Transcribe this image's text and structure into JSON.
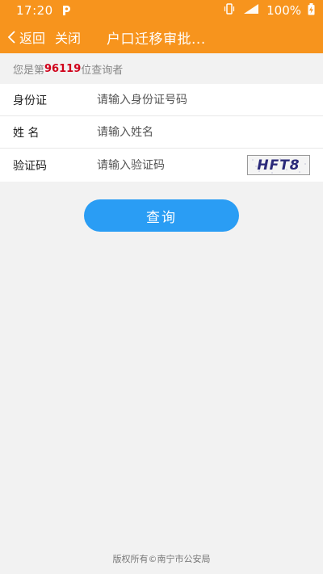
{
  "status_bar": {
    "time": "17:20",
    "battery": "100%",
    "icons": [
      "p-app-icon",
      "vibrate-icon",
      "signal-icon",
      "battery-charging-icon"
    ]
  },
  "nav": {
    "back_label": "返回",
    "close_label": "关闭",
    "title": "户口迁移审批..."
  },
  "counter": {
    "prefix": "您是第",
    "number": "96119",
    "suffix": "位查询者"
  },
  "form": {
    "id_label": "身份证",
    "id_placeholder": "请输入身份证号码",
    "name_label": "姓 名",
    "name_placeholder": "请输入姓名",
    "code_label": "验证码",
    "code_placeholder": "请输入验证码",
    "captcha_text": "HFT8"
  },
  "query_button": "查询",
  "footer": "版权所有©南宁市公安局",
  "colors": {
    "header": "#f7941d",
    "button": "#2a9df4",
    "counter_number": "#d0021b"
  }
}
